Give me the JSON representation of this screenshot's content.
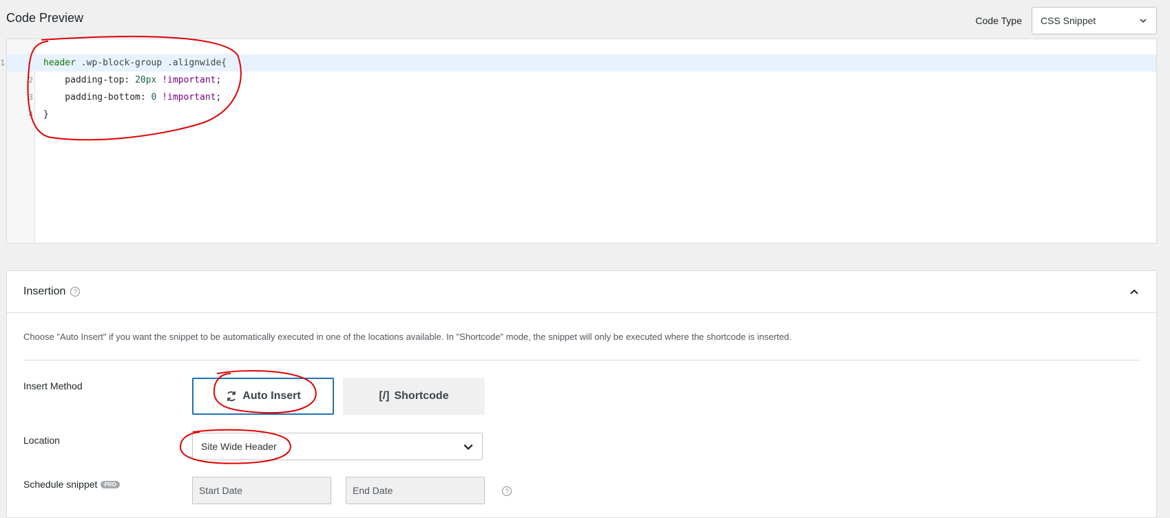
{
  "header": {
    "title": "Code Preview",
    "code_type_label": "Code Type",
    "code_type_value": "CSS Snippet"
  },
  "editor": {
    "lines": [
      {
        "number": "1",
        "selector_tag": "header",
        "selector_rest": " .wp-block-group .alignwide{"
      },
      {
        "number": "2",
        "property": "    padding-top: ",
        "value": "20px",
        "important": "!important",
        "end": ";"
      },
      {
        "number": "3",
        "property": "    padding-bottom: ",
        "value": "0",
        "important": "!important",
        "end": ";"
      },
      {
        "number": "4",
        "closing": "}"
      }
    ]
  },
  "insertion": {
    "title": "Insertion",
    "description": "Choose \"Auto Insert\" if you want the snippet to be automatically executed in one of the locations available. In \"Shortcode\" mode, the snippet will only be executed where the shortcode is inserted.",
    "insert_method_label": "Insert Method",
    "auto_insert_label": "Auto Insert",
    "shortcode_icon": "[/]",
    "shortcode_label": "Shortcode",
    "location_label": "Location",
    "location_value": "Site Wide Header",
    "schedule_label": "Schedule snippet",
    "pro_badge": "PRO",
    "start_date_placeholder": "Start Date",
    "end_date_placeholder": "End Date"
  },
  "icons": {
    "code_type_dropdown": "chevron-down-icon",
    "insertion_help": "help-circle-icon",
    "collapse": "chevron-up-icon",
    "auto_insert": "sync-icon",
    "location_dropdown": "chevron-down-icon",
    "schedule_help": "help-circle-icon"
  },
  "colors": {
    "accent": "#2271b1",
    "annotation": "#e00000",
    "active_line": "#e8f2ff"
  }
}
